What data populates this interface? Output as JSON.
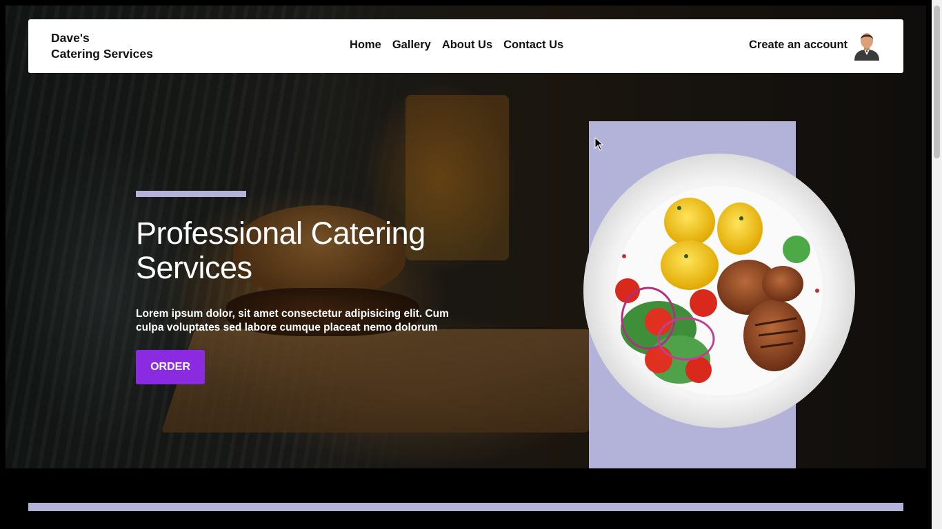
{
  "navbar": {
    "brand_line1": "Dave's",
    "brand_line2": "Catering Services",
    "links": [
      {
        "label": "Home"
      },
      {
        "label": "Gallery"
      },
      {
        "label": "About Us"
      },
      {
        "label": "Contact Us"
      }
    ],
    "create_account_label": "Create an account",
    "avatar_icon": "user-avatar-icon"
  },
  "hero": {
    "title": "Professional Catering Services",
    "text": "Lorem ipsum dolor, sit amet consectetur adipisicing elit. Cum culpa voluptates sed labore cumque placeat nemo dolorum",
    "order_label": "ORDER",
    "image_subject": "plate-of-food"
  },
  "colors": {
    "accent": "#b3b3d9",
    "button": "#8a2be2",
    "navbar_bg": "#ffffff",
    "page_bg": "#000000"
  }
}
